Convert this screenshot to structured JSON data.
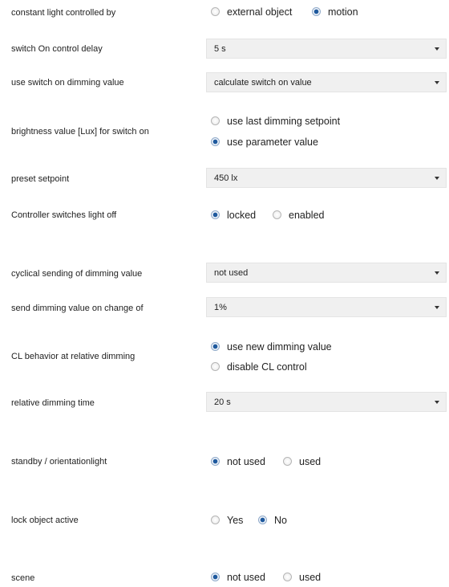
{
  "rows": {
    "constant_light": {
      "label": "constant light controlled by",
      "options": [
        {
          "label": "external object",
          "selected": false
        },
        {
          "label": "motion",
          "selected": true
        }
      ]
    },
    "switch_on_delay": {
      "label": "switch On control delay",
      "value": "5 s"
    },
    "use_switch_on_dimming": {
      "label": "use switch on dimming value",
      "value": "calculate switch on value"
    },
    "brightness_value": {
      "label": "brightness value [Lux] for switch on",
      "options": [
        {
          "label": "use last dimming setpoint",
          "selected": false
        },
        {
          "label": "use parameter value",
          "selected": true
        }
      ]
    },
    "preset_setpoint": {
      "label": "preset setpoint",
      "value": "450 lx"
    },
    "controller_switches_off": {
      "label": "Controller switches light off",
      "options": [
        {
          "label": "locked",
          "selected": true
        },
        {
          "label": "enabled",
          "selected": false
        }
      ]
    },
    "cyclical_sending": {
      "label": "cyclical sending of dimming value",
      "value": "not used"
    },
    "send_on_change": {
      "label": "send dimming value on change of",
      "value": "1%"
    },
    "cl_behavior": {
      "label": "CL behavior at relative dimming",
      "options": [
        {
          "label": "use new dimming value",
          "selected": true
        },
        {
          "label": "disable CL control",
          "selected": false
        }
      ]
    },
    "relative_dimming_time": {
      "label": "relative dimming time",
      "value": "20 s"
    },
    "standby": {
      "label": "standby / orientationlight",
      "options": [
        {
          "label": "not used",
          "selected": true
        },
        {
          "label": "used",
          "selected": false
        }
      ]
    },
    "lock_object": {
      "label": "lock object active",
      "options": [
        {
          "label": "Yes",
          "selected": false
        },
        {
          "label": "No",
          "selected": true
        }
      ]
    },
    "scene": {
      "label": "scene",
      "options": [
        {
          "label": "not used",
          "selected": true
        },
        {
          "label": "used",
          "selected": false
        }
      ]
    }
  },
  "icons": {
    "radio": "radio-button-icon",
    "dropdown": "chevron-down-icon"
  }
}
